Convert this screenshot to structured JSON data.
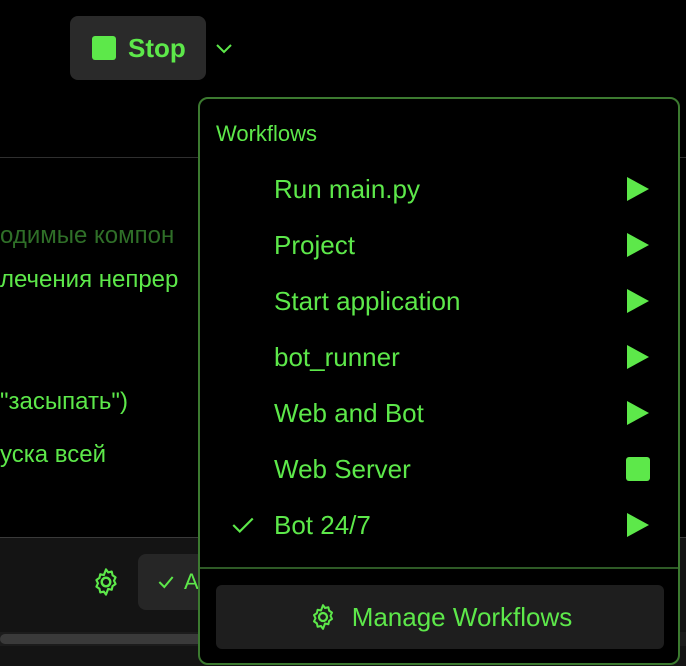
{
  "toolbar": {
    "stop_label": "Stop"
  },
  "background": {
    "lines": [
      "одимые компон",
      "лечения непрер",
      " \"засыпать\")",
      "уска всей"
    ],
    "approve_label": "A"
  },
  "popup": {
    "header": "Workflows",
    "items": [
      {
        "label": "Run main.py",
        "action": "play",
        "checked": false
      },
      {
        "label": "Project",
        "action": "play",
        "checked": false
      },
      {
        "label": "Start application",
        "action": "play",
        "checked": false
      },
      {
        "label": "bot_runner",
        "action": "play",
        "checked": false
      },
      {
        "label": "Web and Bot",
        "action": "play",
        "checked": false
      },
      {
        "label": "Web Server",
        "action": "stop",
        "checked": false
      },
      {
        "label": "Bot 24/7",
        "action": "play",
        "checked": true
      }
    ],
    "manage_label": "Manage Workflows"
  },
  "colors": {
    "accent": "#5de84a",
    "border": "#3c7a30",
    "background": "#000000"
  },
  "icons": {
    "stop": "stop-square-icon",
    "chevron": "chevron-down-icon",
    "play": "play-icon",
    "check": "check-icon",
    "gear": "gear-icon"
  }
}
